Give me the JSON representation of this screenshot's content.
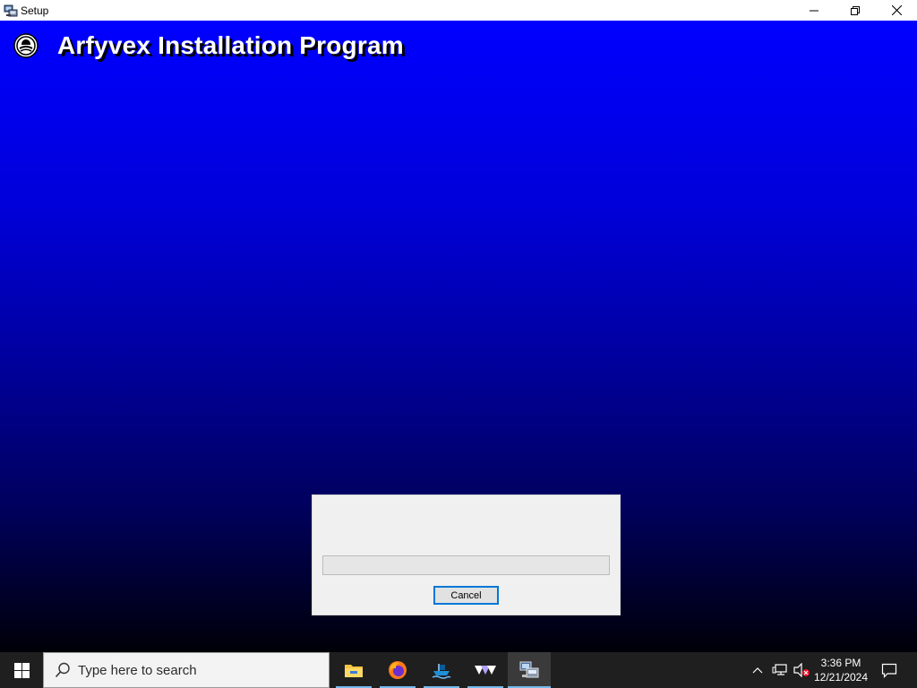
{
  "window": {
    "title": "Setup",
    "controls": [
      "minimize",
      "restore",
      "close"
    ]
  },
  "setup": {
    "title": "Arfyvex Installation Program",
    "logo_icon": "setup-logo-icon",
    "background_top": "#0000ff",
    "background_bottom": "#000008"
  },
  "progress_dialog": {
    "status": "",
    "progress": 0,
    "cancel_label": "Cancel"
  },
  "taskbar": {
    "search_placeholder": "Type here to search",
    "apps": [
      {
        "name": "file-explorer-icon"
      },
      {
        "name": "firefox-icon"
      },
      {
        "name": "app-boat-icon"
      },
      {
        "name": "app-wave-icon"
      },
      {
        "name": "setup-icon",
        "active": true
      }
    ],
    "clock": {
      "time": "3:36 PM",
      "date": "12/21/2024"
    }
  }
}
